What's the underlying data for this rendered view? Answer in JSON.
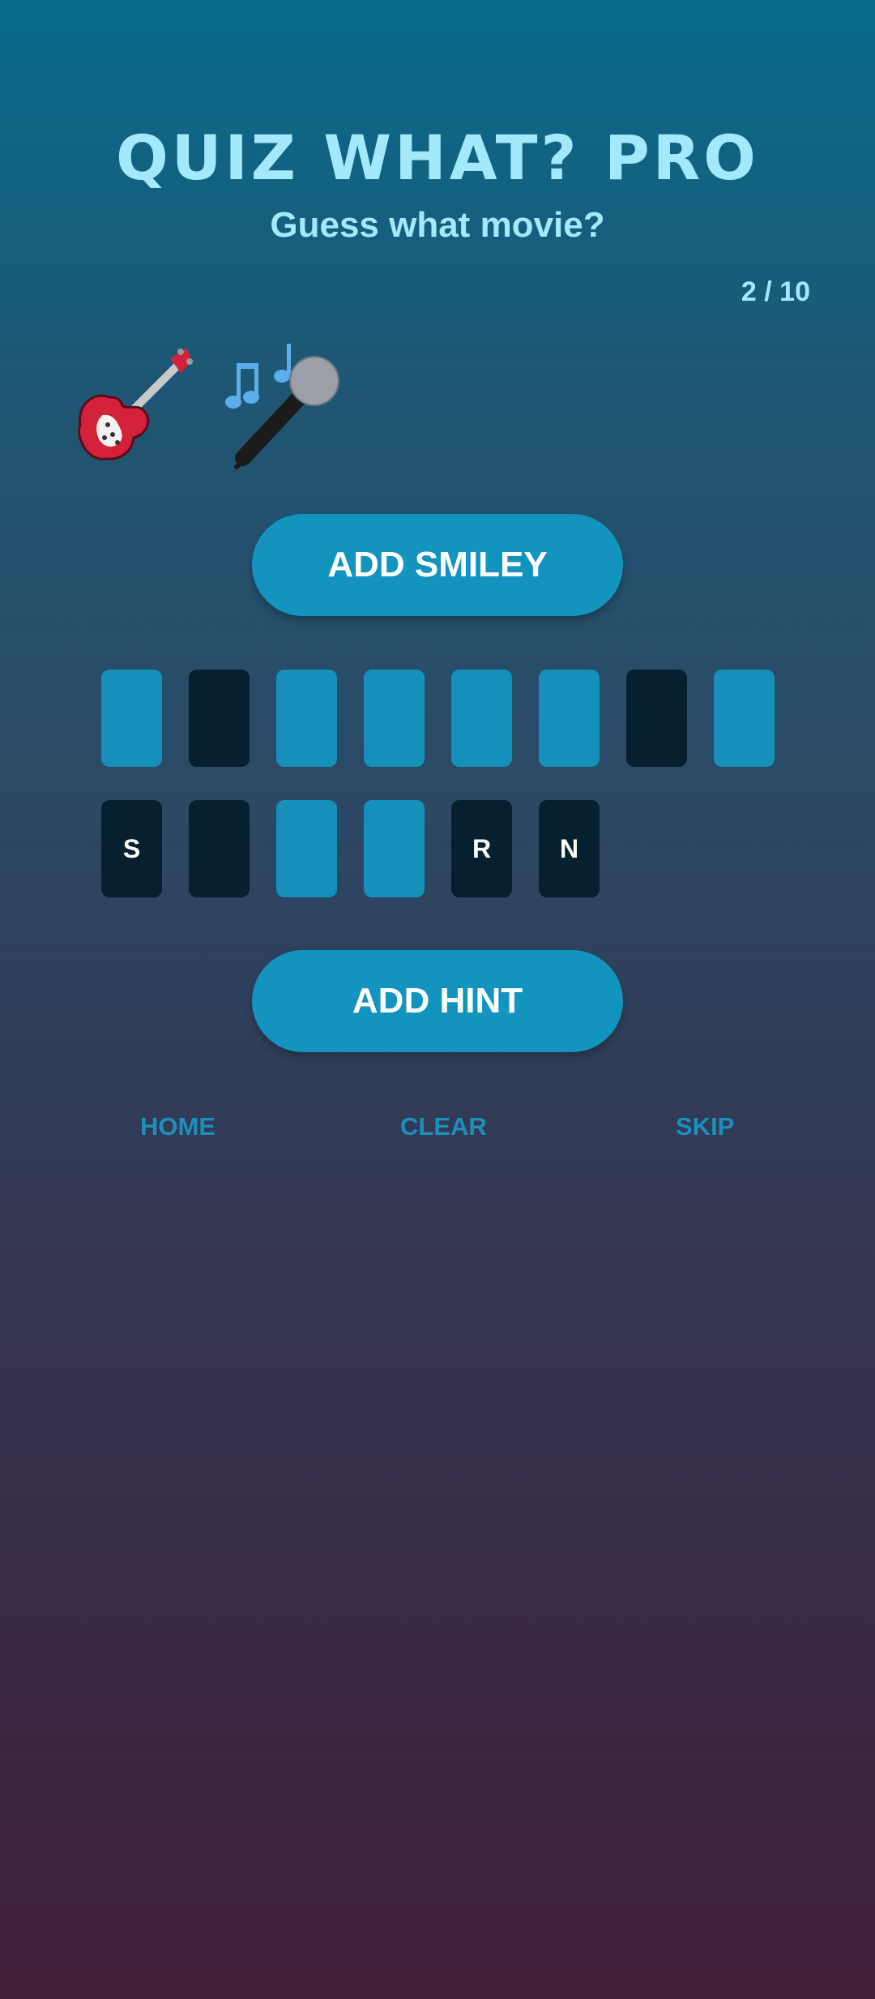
{
  "header": {
    "title": "QUIZ WHAT? PRO",
    "subtitle": "Guess what movie?",
    "progress": "2 / 10"
  },
  "clue": {
    "emojis": [
      "guitar-emoji",
      "musical-notes-microphone-emoji"
    ]
  },
  "buttons": {
    "add_smiley": "ADD SMILEY",
    "add_hint": "ADD HINT"
  },
  "answer_row_1": [
    {
      "letter": "",
      "state": "empty"
    },
    {
      "letter": "",
      "state": "filled"
    },
    {
      "letter": "",
      "state": "empty"
    },
    {
      "letter": "",
      "state": "empty"
    },
    {
      "letter": "",
      "state": "empty"
    },
    {
      "letter": "",
      "state": "empty"
    },
    {
      "letter": "",
      "state": "filled"
    },
    {
      "letter": "",
      "state": "empty"
    }
  ],
  "answer_row_2": [
    {
      "letter": "S",
      "state": "filled"
    },
    {
      "letter": "",
      "state": "filled"
    },
    {
      "letter": "",
      "state": "empty"
    },
    {
      "letter": "",
      "state": "empty"
    },
    {
      "letter": "R",
      "state": "filled"
    },
    {
      "letter": "N",
      "state": "filled"
    }
  ],
  "nav": {
    "home": "HOME",
    "clear": "CLEAR",
    "skip": "SKIP"
  },
  "colors": {
    "accent_text": "#a3e8fb",
    "button": "#1394be",
    "tile_empty": "#1490bb",
    "tile_filled": "#07202f",
    "nav_text": "#1c8fbc"
  }
}
